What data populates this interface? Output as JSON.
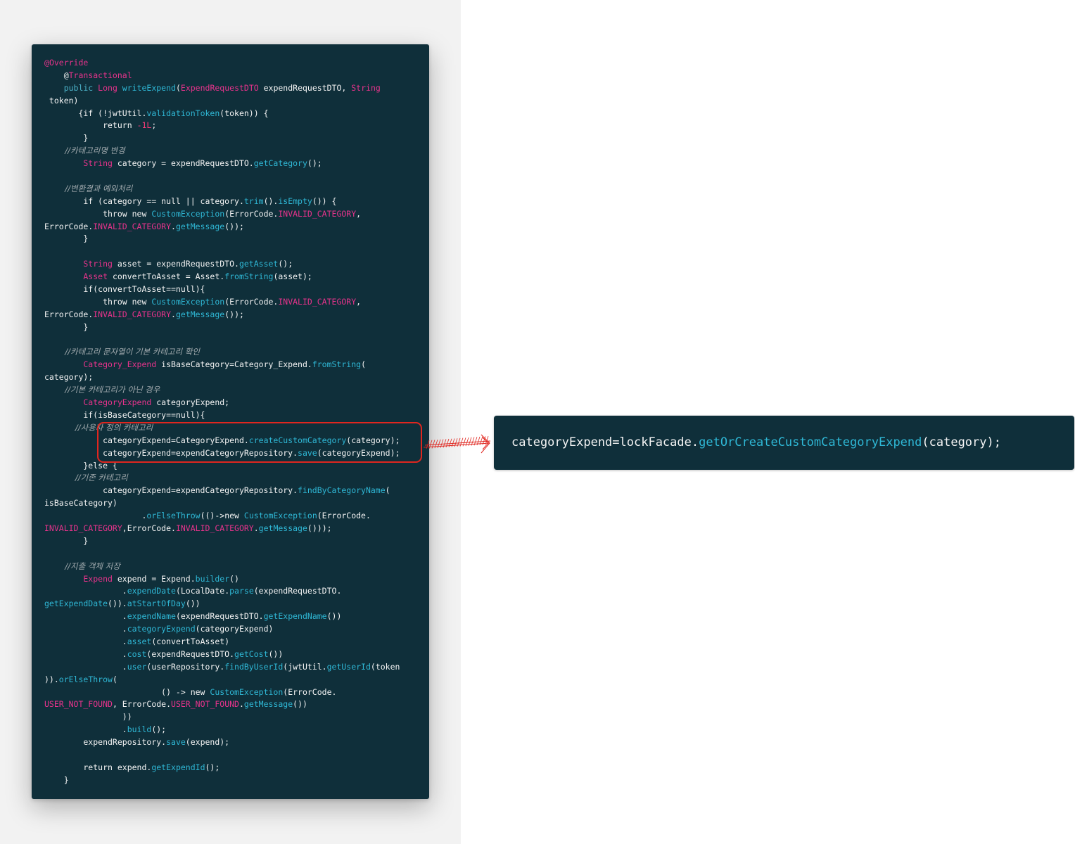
{
  "colors": {
    "code_background": "#0f2f3a",
    "plain_text": "#f4f4f4",
    "keyword": "#4cb3c9",
    "type_name": "#e8338c",
    "method": "#2fb8d6",
    "comment": "#a0a9ad",
    "highlight_border": "#e0261f",
    "page_left_background": "#f2f2f2"
  },
  "code_block": {
    "lines": [
      [
        [
          "anno",
          "@"
        ],
        [
          "type",
          "Override"
        ]
      ],
      [
        [
          "plain",
          "    @"
        ],
        [
          "type",
          "Transactional"
        ]
      ],
      [
        [
          "kw",
          "    public "
        ],
        [
          "type",
          "Long "
        ],
        [
          "fn",
          "writeExpend"
        ],
        [
          "plain",
          "("
        ],
        [
          "type",
          "ExpendRequestDTO"
        ],
        [
          "plain",
          " expendRequestDTO, "
        ],
        [
          "type",
          "String"
        ]
      ],
      [
        [
          "plain",
          " token)"
        ]
      ],
      [
        [
          "plain",
          "       {if (!jwtUtil."
        ],
        [
          "fn",
          "validationToken"
        ],
        [
          "plain",
          "(token)) {"
        ]
      ],
      [
        [
          "plain",
          "            return "
        ],
        [
          "num",
          "-1L"
        ],
        [
          "plain",
          ";"
        ]
      ],
      [
        [
          "plain",
          "        }"
        ]
      ],
      [
        [
          "comment",
          "        //카테고리명 변경"
        ]
      ],
      [
        [
          "type",
          "        String"
        ],
        [
          "plain",
          " category = expendRequestDTO."
        ],
        [
          "fn",
          "getCategory"
        ],
        [
          "plain",
          "();"
        ]
      ],
      [
        [
          "plain",
          ""
        ]
      ],
      [
        [
          "comment",
          "        //변환결과 예외처리"
        ]
      ],
      [
        [
          "plain",
          "        if (category == null || category."
        ],
        [
          "fn",
          "trim"
        ],
        [
          "plain",
          "()."
        ],
        [
          "fn",
          "isEmpty"
        ],
        [
          "plain",
          "()) {"
        ]
      ],
      [
        [
          "plain",
          "            throw new "
        ],
        [
          "fn",
          "CustomException"
        ],
        [
          "plain",
          "(ErrorCode."
        ],
        [
          "const",
          "INVALID_CATEGORY"
        ],
        [
          "plain",
          ","
        ]
      ],
      [
        [
          "plain",
          "ErrorCode."
        ],
        [
          "const",
          "INVALID_CATEGORY"
        ],
        [
          "plain",
          "."
        ],
        [
          "fn",
          "getMessage"
        ],
        [
          "plain",
          "());"
        ]
      ],
      [
        [
          "plain",
          "        }"
        ]
      ],
      [
        [
          "plain",
          ""
        ]
      ],
      [
        [
          "type",
          "        String"
        ],
        [
          "plain",
          " asset = expendRequestDTO."
        ],
        [
          "fn",
          "getAsset"
        ],
        [
          "plain",
          "();"
        ]
      ],
      [
        [
          "type",
          "        Asset"
        ],
        [
          "plain",
          " convertToAsset = Asset."
        ],
        [
          "fn",
          "fromString"
        ],
        [
          "plain",
          "(asset);"
        ]
      ],
      [
        [
          "plain",
          "        if(convertToAsset==null){"
        ]
      ],
      [
        [
          "plain",
          "            throw new "
        ],
        [
          "fn",
          "CustomException"
        ],
        [
          "plain",
          "(ErrorCode."
        ],
        [
          "const",
          "INVALID_CATEGORY"
        ],
        [
          "plain",
          ","
        ]
      ],
      [
        [
          "plain",
          "ErrorCode."
        ],
        [
          "const",
          "INVALID_CATEGORY"
        ],
        [
          "plain",
          "."
        ],
        [
          "fn",
          "getMessage"
        ],
        [
          "plain",
          "());"
        ]
      ],
      [
        [
          "plain",
          "        }"
        ]
      ],
      [
        [
          "plain",
          ""
        ]
      ],
      [
        [
          "comment",
          "        //카테고리 문자열이 기본 카테고리 확인"
        ]
      ],
      [
        [
          "type",
          "        Category_Expend"
        ],
        [
          "plain",
          " isBaseCategory=Category_Expend."
        ],
        [
          "fn",
          "fromString"
        ],
        [
          "plain",
          "("
        ]
      ],
      [
        [
          "plain",
          "category);"
        ]
      ],
      [
        [
          "comment",
          "        //기본 카테고리가 아닌 경우"
        ]
      ],
      [
        [
          "type",
          "        CategoryExpend"
        ],
        [
          "plain",
          " categoryExpend;"
        ]
      ],
      [
        [
          "plain",
          "        if(isBaseCategory==null){"
        ]
      ],
      [
        [
          "comment",
          "            //사용자 정의 카테고리"
        ]
      ],
      [
        [
          "plain",
          "            categoryExpend=CategoryExpend."
        ],
        [
          "fn",
          "createCustomCategory"
        ],
        [
          "plain",
          "(category);"
        ]
      ],
      [
        [
          "plain",
          "            categoryExpend=expendCategoryRepository."
        ],
        [
          "fn",
          "save"
        ],
        [
          "plain",
          "(categoryExpend);"
        ]
      ],
      [
        [
          "plain",
          "        }else {"
        ]
      ],
      [
        [
          "comment",
          "            //기존 카테고리"
        ]
      ],
      [
        [
          "plain",
          "            categoryExpend=expendCategoryRepository."
        ],
        [
          "fn",
          "findByCategoryName"
        ],
        [
          "plain",
          "("
        ]
      ],
      [
        [
          "plain",
          "isBaseCategory)"
        ]
      ],
      [
        [
          "plain",
          "                    ."
        ],
        [
          "fn",
          "orElseThrow"
        ],
        [
          "plain",
          "(()->new "
        ],
        [
          "fn",
          "CustomException"
        ],
        [
          "plain",
          "(ErrorCode."
        ]
      ],
      [
        [
          "const",
          "INVALID_CATEGORY"
        ],
        [
          "plain",
          ",ErrorCode."
        ],
        [
          "const",
          "INVALID_CATEGORY"
        ],
        [
          "plain",
          "."
        ],
        [
          "fn",
          "getMessage"
        ],
        [
          "plain",
          "()));"
        ]
      ],
      [
        [
          "plain",
          "        }"
        ]
      ],
      [
        [
          "plain",
          ""
        ]
      ],
      [
        [
          "comment",
          "        //지출 객체 저장"
        ]
      ],
      [
        [
          "type",
          "        Expend"
        ],
        [
          "plain",
          " expend = Expend."
        ],
        [
          "fn",
          "builder"
        ],
        [
          "plain",
          "()"
        ]
      ],
      [
        [
          "plain",
          "                ."
        ],
        [
          "fn",
          "expendDate"
        ],
        [
          "plain",
          "(LocalDate."
        ],
        [
          "fn",
          "parse"
        ],
        [
          "plain",
          "(expendRequestDTO."
        ]
      ],
      [
        [
          "fn",
          "getExpendDate"
        ],
        [
          "plain",
          "())."
        ],
        [
          "fn",
          "atStartOfDay"
        ],
        [
          "plain",
          "())"
        ]
      ],
      [
        [
          "plain",
          "                ."
        ],
        [
          "fn",
          "expendName"
        ],
        [
          "plain",
          "(expendRequestDTO."
        ],
        [
          "fn",
          "getExpendName"
        ],
        [
          "plain",
          "())"
        ]
      ],
      [
        [
          "plain",
          "                ."
        ],
        [
          "fn",
          "categoryExpend"
        ],
        [
          "plain",
          "(categoryExpend)"
        ]
      ],
      [
        [
          "plain",
          "                ."
        ],
        [
          "fn",
          "asset"
        ],
        [
          "plain",
          "(convertToAsset)"
        ]
      ],
      [
        [
          "plain",
          "                ."
        ],
        [
          "fn",
          "cost"
        ],
        [
          "plain",
          "(expendRequestDTO."
        ],
        [
          "fn",
          "getCost"
        ],
        [
          "plain",
          "())"
        ]
      ],
      [
        [
          "plain",
          "                ."
        ],
        [
          "fn",
          "user"
        ],
        [
          "plain",
          "(userRepository."
        ],
        [
          "fn",
          "findByUserId"
        ],
        [
          "plain",
          "(jwtUtil."
        ],
        [
          "fn",
          "getUserId"
        ],
        [
          "plain",
          "(token"
        ]
      ],
      [
        [
          "plain",
          "))."
        ],
        [
          "fn",
          "orElseThrow"
        ],
        [
          "plain",
          "("
        ]
      ],
      [
        [
          "plain",
          "                        () -> new "
        ],
        [
          "fn",
          "CustomException"
        ],
        [
          "plain",
          "(ErrorCode."
        ]
      ],
      [
        [
          "const",
          "USER_NOT_FOUND"
        ],
        [
          "plain",
          ", ErrorCode."
        ],
        [
          "const",
          "USER_NOT_FOUND"
        ],
        [
          "plain",
          "."
        ],
        [
          "fn",
          "getMessage"
        ],
        [
          "plain",
          "())"
        ]
      ],
      [
        [
          "plain",
          "                ))"
        ]
      ],
      [
        [
          "plain",
          "                ."
        ],
        [
          "fn",
          "build"
        ],
        [
          "plain",
          "();"
        ]
      ],
      [
        [
          "plain",
          "        expendRepository."
        ],
        [
          "fn",
          "save"
        ],
        [
          "plain",
          "(expend);"
        ]
      ],
      [
        [
          "plain",
          ""
        ]
      ],
      [
        [
          "plain",
          "        return expend."
        ],
        [
          "fn",
          "getExpendId"
        ],
        [
          "plain",
          "();"
        ]
      ],
      [
        [
          "plain",
          "    }"
        ]
      ]
    ]
  },
  "snippet": {
    "parts": [
      [
        "plain",
        "categoryExpend=lockFacade."
      ],
      [
        "fn",
        "getOrCreateCustomCategoryExpend"
      ],
      [
        "plain",
        "(category);"
      ]
    ]
  }
}
